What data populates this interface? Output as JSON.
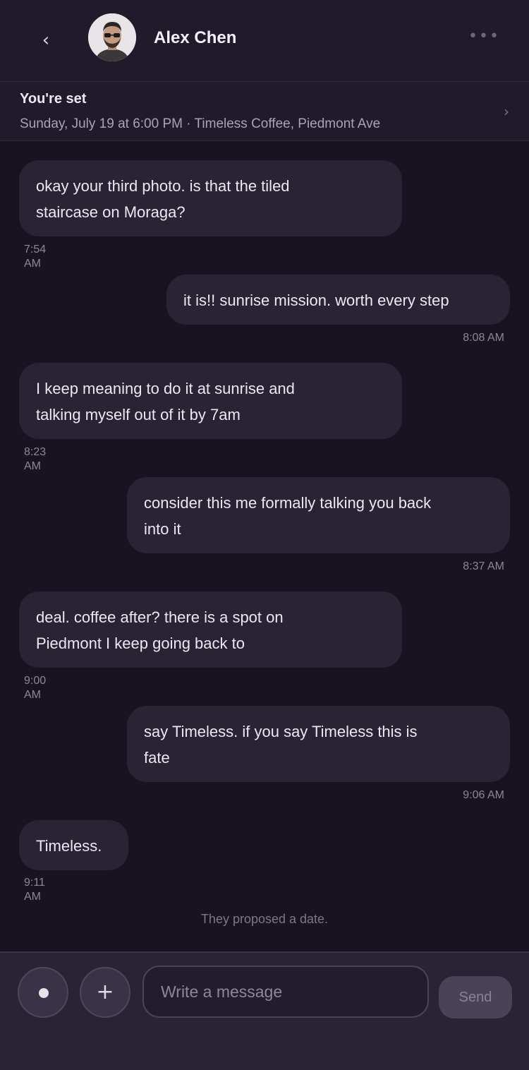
{
  "header": {
    "back_icon": "chevron-left-icon",
    "contact_name": "Alex Chen",
    "more_icon": "more-horizontal-icon"
  },
  "banner": {
    "title": "You're set",
    "detail": "Sunday, July 19 at 6:00 PM · Timeless Coffee, Piedmont Ave",
    "chevron_icon": "chevron-right-icon"
  },
  "messages": [
    {
      "side": "received",
      "lines": [
        "okay your third photo. is that the tiled",
        "staircase on Moraga?"
      ],
      "time": "7:54 AM"
    },
    {
      "side": "sent",
      "lines": [
        "it is!! sunrise mission. worth every step"
      ],
      "time": "8:08 AM"
    },
    {
      "side": "received",
      "lines": [
        "I keep meaning to do it at sunrise and",
        "talking myself out of it by 7am"
      ],
      "time": "8:23 AM"
    },
    {
      "side": "sent",
      "lines": [
        "consider this me formally talking you back",
        "into it"
      ],
      "time": "8:37 AM"
    },
    {
      "side": "received",
      "lines": [
        "deal. coffee after? there is a spot on",
        "Piedmont I keep going back to"
      ],
      "time": "9:00 AM"
    },
    {
      "side": "sent",
      "lines": [
        "say Timeless. if you say Timeless this is",
        "fate"
      ],
      "time": "9:06 AM"
    },
    {
      "side": "received",
      "lines": [
        "Timeless."
      ],
      "time": "9:11 AM"
    }
  ],
  "system_note": "They proposed a date.",
  "composer": {
    "record_icon": "record-icon",
    "add_icon": "plus-icon",
    "input_placeholder": "Write a message",
    "input_value": "",
    "send_label": "Send"
  }
}
